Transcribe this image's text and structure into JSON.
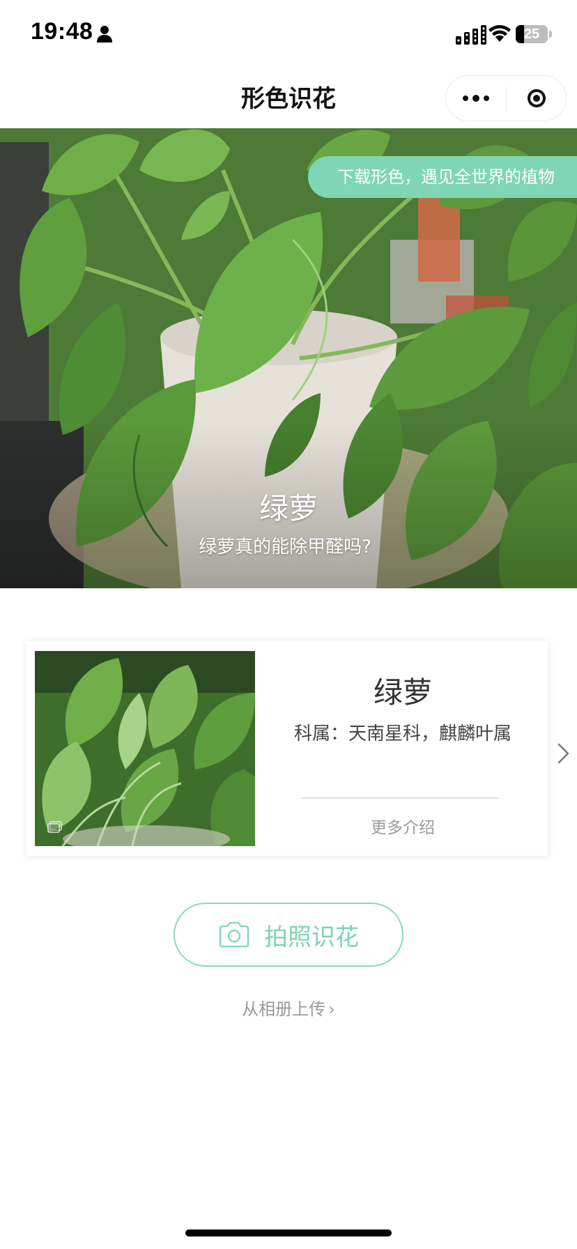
{
  "status_bar": {
    "time": "19:48",
    "battery_level": "25",
    "battery_fraction": 0.25
  },
  "nav": {
    "title": "形色识花"
  },
  "hero": {
    "promo_text": "下载形色，遇见全世界的植物",
    "plant_name": "绿萝",
    "question": "绿萝真的能除甲醛吗?"
  },
  "result_card": {
    "name": "绿萝",
    "family": "科属：天南星科，麒麟叶属",
    "more_label": "更多介绍"
  },
  "actions": {
    "photo_button_label": "拍照识花",
    "upload_label": "从相册上传",
    "upload_chevron": "›"
  },
  "icons": {
    "person": "person-icon",
    "signal": "cellular-signal-icon",
    "wifi": "wifi-icon",
    "more": "more-dots-icon",
    "close": "target-circle-icon",
    "camera": "camera-icon",
    "next": "chevron-right-icon",
    "thumb_corner": "gallery-icon"
  },
  "colors": {
    "accent": "#7fd6b4",
    "button_border": "#8ad8bb",
    "muted_text": "#999999"
  }
}
